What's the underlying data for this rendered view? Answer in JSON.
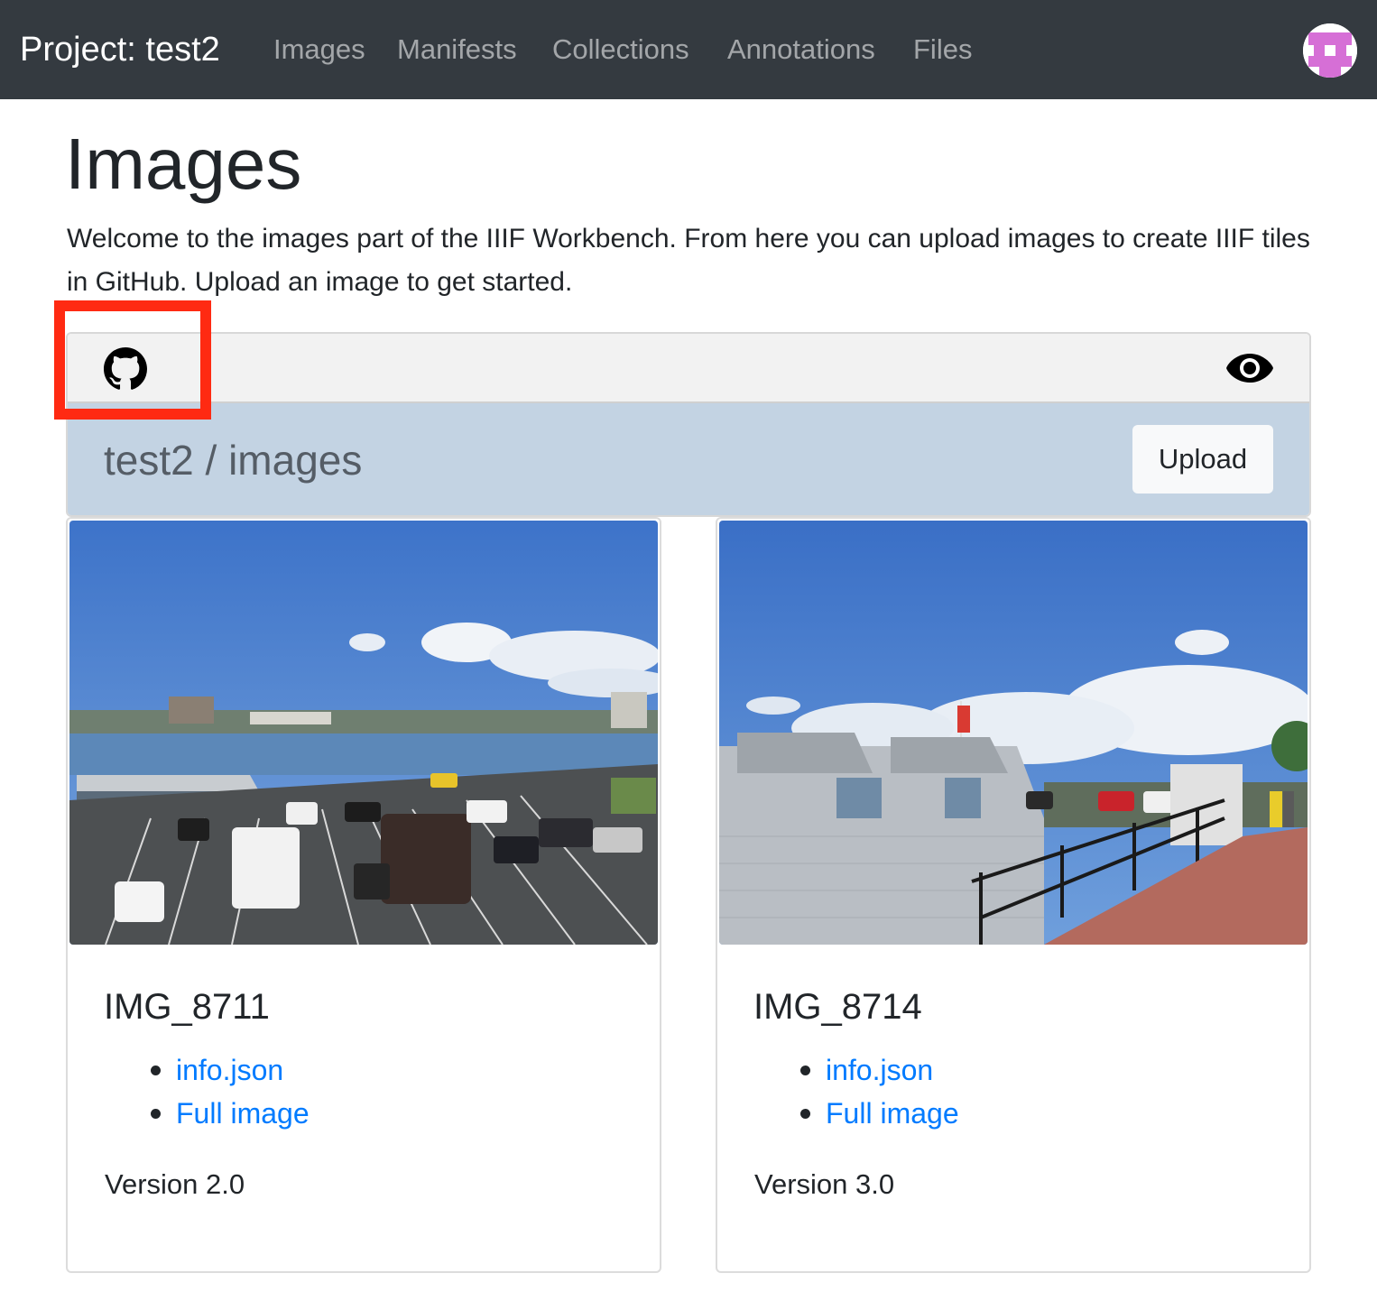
{
  "navbar": {
    "brand": "Project: test2",
    "links": [
      "Images",
      "Manifests",
      "Collections",
      "Annotations",
      "Files"
    ],
    "avatar_color": "#d66fd6"
  },
  "page": {
    "title": "Images",
    "intro": "Welcome to the images part of the IIIF Workbench. From here you can upload images to create IIIF tiles in GitHub. Upload an image to get started."
  },
  "panel": {
    "left_icon": "github-icon",
    "right_icon": "eye-icon",
    "repo_path": "test2 / images",
    "upload_label": "Upload",
    "highlight_color": "#ff2a12"
  },
  "cards": [
    {
      "title": "IMG_8711",
      "links": [
        "info.json",
        "Full image"
      ],
      "version": "Version 2.0",
      "image_subject": "harbour-parking-lot-photo"
    },
    {
      "title": "IMG_8714",
      "links": [
        "info.json",
        "Full image"
      ],
      "version": "Version 3.0",
      "image_subject": "waterfront-walkway-building-photo"
    }
  ],
  "colors": {
    "navbar_bg": "#343a40",
    "link": "#007bff",
    "panel_header_bg": "#c3d3e3"
  }
}
